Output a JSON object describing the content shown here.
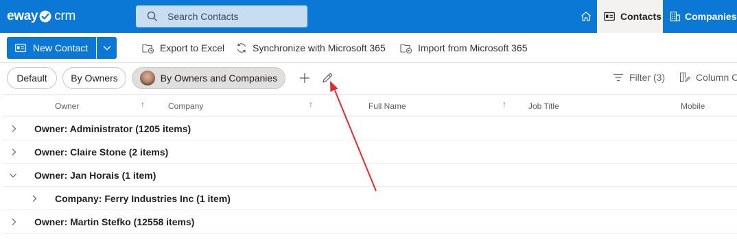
{
  "app": {
    "logo_text": "eway",
    "logo_suffix": "crm",
    "search": {
      "placeholder": "Search Contacts"
    },
    "nav": {
      "home_icon": "home-icon",
      "contacts_label": "Contacts",
      "companies_label": "Companies"
    }
  },
  "toolbar": {
    "new_contact_label": "New Contact",
    "export_label": "Export to Excel",
    "sync_label": "Synchronize with Microsoft 365",
    "import_label": "Import from Microsoft 365"
  },
  "views": {
    "items": [
      {
        "label": "Default"
      },
      {
        "label": "By Owners"
      },
      {
        "label": "By Owners and Companies",
        "active": true
      }
    ],
    "filter_label": "Filter (3)",
    "column_chooser_label": "Column C"
  },
  "grid": {
    "columns": [
      "Owner",
      "Company",
      "Full Name",
      "Job Title",
      "Mobile"
    ],
    "sort_indicator": "↑",
    "rows": [
      {
        "label": "Owner: Administrator (1205 items)",
        "level": 0,
        "expanded": false
      },
      {
        "label": "Owner: Claire Stone (2 items)",
        "level": 0,
        "expanded": false
      },
      {
        "label": "Owner: Jan Horais (1 item)",
        "level": 0,
        "expanded": true
      },
      {
        "label": "Company: Ferry Industries Inc (1 item)",
        "level": 1,
        "expanded": false
      },
      {
        "label": "Owner: Martin Stefko (12558 items)",
        "level": 0,
        "expanded": false
      }
    ]
  },
  "colors": {
    "accent": "#0a78d4",
    "annotation_arrow": "#e0282e"
  }
}
